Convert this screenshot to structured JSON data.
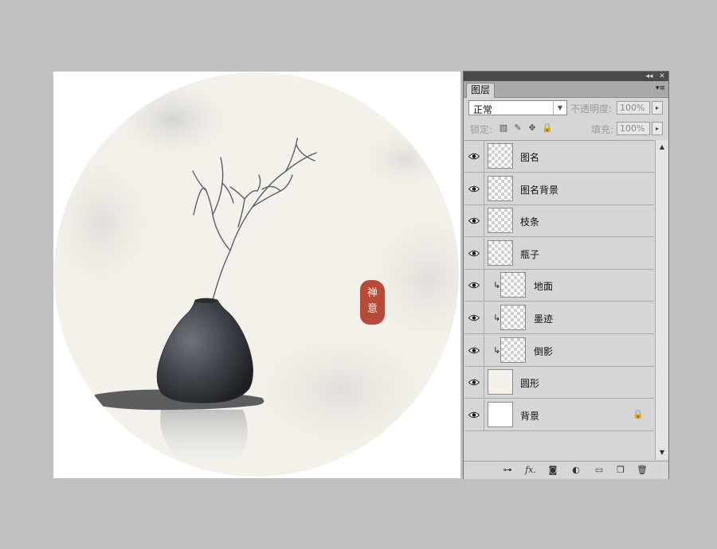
{
  "canvas": {
    "seal": {
      "char1": "禅",
      "char2": "意",
      "color": "#b84a3a"
    }
  },
  "panel": {
    "tab_label": "图层",
    "title_buttons": {
      "collapse": "◂◂",
      "close": "✕"
    },
    "menu_icon": "panel-menu-icon",
    "blend_mode": "正常",
    "opacity_label": "不透明度:",
    "opacity_value": "100%",
    "lock_label": "锁定:",
    "fill_label": "填充:",
    "fill_value": "100%",
    "layers": [
      {
        "name": "图名",
        "visible": true,
        "clipped": false,
        "thumb": "transparent"
      },
      {
        "name": "图名背景",
        "visible": true,
        "clipped": false,
        "thumb": "transparent"
      },
      {
        "name": "枝条",
        "visible": true,
        "clipped": false,
        "thumb": "transparent"
      },
      {
        "name": "瓶子",
        "visible": true,
        "clipped": false,
        "thumb": "transparent"
      },
      {
        "name": "地面",
        "visible": true,
        "clipped": true,
        "thumb": "transparent"
      },
      {
        "name": "墨迹",
        "visible": true,
        "clipped": true,
        "thumb": "transparent"
      },
      {
        "name": "倒影",
        "visible": true,
        "clipped": true,
        "thumb": "transparent"
      },
      {
        "name": "圆形",
        "visible": true,
        "clipped": false,
        "thumb": "cream"
      },
      {
        "name": "背景",
        "visible": true,
        "clipped": false,
        "thumb": "white",
        "locked": true
      }
    ],
    "bottom_icons": [
      "link-layers-icon",
      "fx-icon",
      "add-mask-icon",
      "adjustment-layer-icon",
      "new-group-icon",
      "new-layer-icon",
      "delete-layer-icon"
    ],
    "fx_text": "fx."
  },
  "colors": {
    "workspace": "#c0c0c0",
    "panel": "#d6d6d6",
    "circle_fill": "#f3f1ea"
  }
}
